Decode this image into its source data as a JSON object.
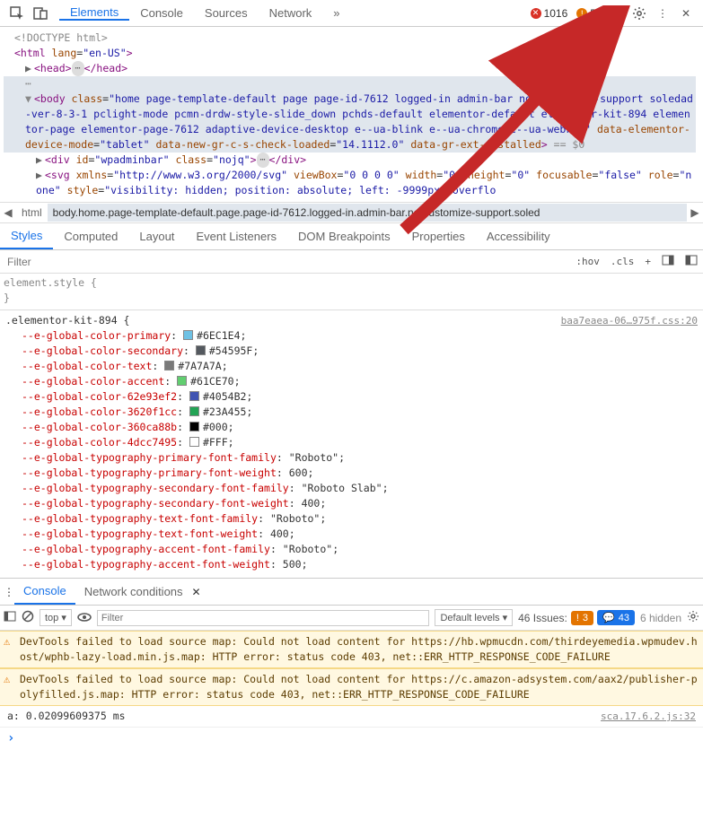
{
  "toolbar": {
    "tabs": [
      "Elements",
      "Console",
      "Sources",
      "Network"
    ],
    "more_glyph": "»",
    "errors": "1016",
    "warnings": "5",
    "issues_icon": "!",
    "issues": "3"
  },
  "dom": {
    "doctype": "<!DOCTYPE html>",
    "html_open": "<html lang=\"en-US\">",
    "head_line": "<head>…</head>",
    "body_line": "<body class=\"home page-template-default page page-id-7612 logged-in admin-bar no-customize-support soledad-ver-8-3-1 pclight-mode pcmn-drdw-style-slide_down pchds-default elementor-default elementor-kit-894 elementor-page elementor-page-7612 adaptive-device-desktop e--ua-blink e--ua-chrome e--ua-webkit\" data-elementor-device-mode=\"tablet\" data-new-gr-c-s-check-loaded=\"14.1112.0\" data-gr-ext-installed> == $0",
    "div_line": "<div id=\"wpadminbar\" class=\"nojq\">…</div>",
    "svg_line": "<svg xmlns=\"http://www.w3.org/2000/svg\" viewBox=\"0 0 0 0\" width=\"0\" height=\"0\" focusable=\"false\" role=\"none\" style=\"visibility: hidden; position: absolute; left: -9999px; overflo"
  },
  "breadcrumb": {
    "html": "html",
    "body": "body.home.page-template-default.page.page-id-7612.logged-in.admin-bar.no-customize-support.soled"
  },
  "styles_panel": {
    "tabs": [
      "Styles",
      "Computed",
      "Layout",
      "Event Listeners",
      "DOM Breakpoints",
      "Properties",
      "Accessibility"
    ],
    "filter_placeholder": "Filter",
    "hov": ":hov",
    "cls": ".cls",
    "element_style": "element.style {",
    "close_brace": "}",
    "rule_selector": ".elementor-kit-894 {",
    "rule_source": "baa7eaea-06…975f.css:20",
    "decls": [
      {
        "prop": "--e-global-color-primary",
        "val": "#6EC1E4",
        "swatch": "#6EC1E4"
      },
      {
        "prop": "--e-global-color-secondary",
        "val": "#54595F",
        "swatch": "#54595F"
      },
      {
        "prop": "--e-global-color-text",
        "val": "#7A7A7A",
        "swatch": "#7A7A7A"
      },
      {
        "prop": "--e-global-color-accent",
        "val": "#61CE70",
        "swatch": "#61CE70"
      },
      {
        "prop": "--e-global-color-62e93ef2",
        "val": "#4054B2",
        "swatch": "#4054B2"
      },
      {
        "prop": "--e-global-color-3620f1cc",
        "val": "#23A455",
        "swatch": "#23A455"
      },
      {
        "prop": "--e-global-color-360ca88b",
        "val": "#000",
        "swatch": "#000000"
      },
      {
        "prop": "--e-global-color-4dcc7495",
        "val": "#FFF",
        "swatch": "#FFFFFF"
      },
      {
        "prop": "--e-global-typography-primary-font-family",
        "val": "\"Roboto\""
      },
      {
        "prop": "--e-global-typography-primary-font-weight",
        "val": "600"
      },
      {
        "prop": "--e-global-typography-secondary-font-family",
        "val": "\"Roboto Slab\""
      },
      {
        "prop": "--e-global-typography-secondary-font-weight",
        "val": "400"
      },
      {
        "prop": "--e-global-typography-text-font-family",
        "val": "\"Roboto\""
      },
      {
        "prop": "--e-global-typography-text-font-weight",
        "val": "400"
      },
      {
        "prop": "--e-global-typography-accent-font-family",
        "val": "\"Roboto\""
      },
      {
        "prop": "--e-global-typography-accent-font-weight",
        "val": "500"
      }
    ]
  },
  "console": {
    "tabs": [
      "Console",
      "Network conditions"
    ],
    "top": "top ▾",
    "filter_placeholder": "Filter",
    "levels": "Default levels ▾",
    "issues_label": "46 Issues:",
    "issues_warn": "3",
    "issues_blue": "43",
    "hidden": "6 hidden",
    "warn1": "DevTools failed to load source map: Could not load content for https://hb.wpmucdn.com/thirdeyemedia.wpmudev.host/wphb-lazy-load.min.js.map: HTTP error: status code 403, net::ERR_HTTP_RESPONSE_CODE_FAILURE",
    "warn2": "DevTools failed to load source map: Could not load content for https://c.amazon-adsystem.com/aax2/publisher-polyfilled.js.map: HTTP error: status code 403, net::ERR_HTTP_RESPONSE_CODE_FAILURE",
    "log": "a: 0.02099609375 ms",
    "log_src": "sca.17.6.2.js:32",
    "prompt": "›"
  }
}
